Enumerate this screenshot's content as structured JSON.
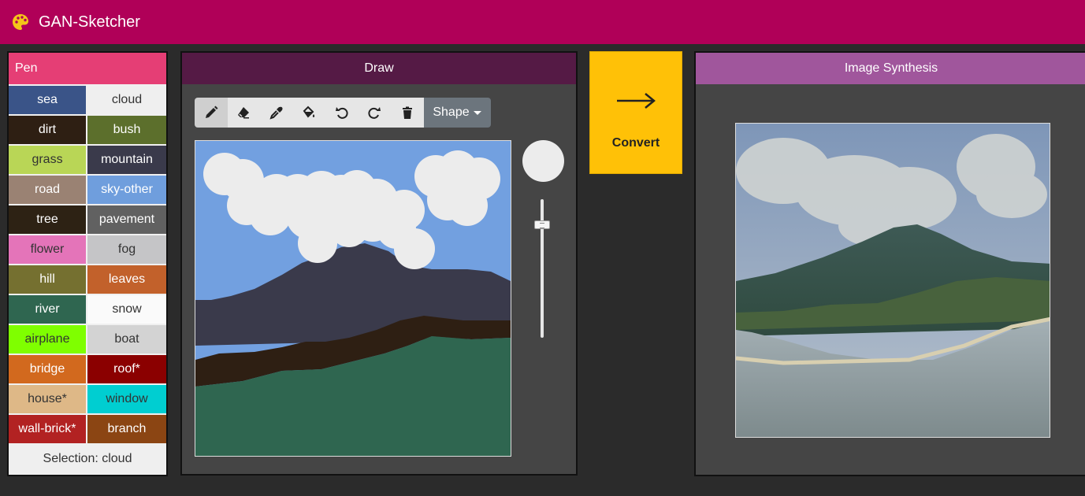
{
  "app": {
    "title": "GAN-Sketcher",
    "logo_icon": "palette-icon"
  },
  "pen": {
    "header": "Pen",
    "items": [
      {
        "label": "sea",
        "bg": "#3a5488",
        "fg": "#ffffff"
      },
      {
        "label": "cloud",
        "bg": "#efefef",
        "fg": "#333333"
      },
      {
        "label": "dirt",
        "bg": "#2e1f13",
        "fg": "#ffffff"
      },
      {
        "label": "bush",
        "bg": "#5c6f2c",
        "fg": "#ffffff"
      },
      {
        "label": "grass",
        "bg": "#b9d656",
        "fg": "#333333"
      },
      {
        "label": "mountain",
        "bg": "#3a3a4b",
        "fg": "#ffffff"
      },
      {
        "label": "road",
        "bg": "#9a8273",
        "fg": "#ffffff"
      },
      {
        "label": "sky-other",
        "bg": "#6f9edd",
        "fg": "#ffffff"
      },
      {
        "label": "tree",
        "bg": "#2d2214",
        "fg": "#ffffff"
      },
      {
        "label": "pavement",
        "bg": "#616161",
        "fg": "#ffffff"
      },
      {
        "label": "flower",
        "bg": "#e474b9",
        "fg": "#333333"
      },
      {
        "label": "fog",
        "bg": "#c5c5c7",
        "fg": "#333333"
      },
      {
        "label": "hill",
        "bg": "#757030",
        "fg": "#ffffff"
      },
      {
        "label": "leaves",
        "bg": "#c2612b",
        "fg": "#ffffff"
      },
      {
        "label": "river",
        "bg": "#2f6650",
        "fg": "#ffffff"
      },
      {
        "label": "snow",
        "bg": "#fafafa",
        "fg": "#333333"
      },
      {
        "label": "airplane",
        "bg": "#7fff00",
        "fg": "#333333"
      },
      {
        "label": "boat",
        "bg": "#d3d3d3",
        "fg": "#333333"
      },
      {
        "label": "bridge",
        "bg": "#d2691e",
        "fg": "#ffffff"
      },
      {
        "label": "roof*",
        "bg": "#8b0000",
        "fg": "#ffffff"
      },
      {
        "label": "house*",
        "bg": "#deb887",
        "fg": "#333333"
      },
      {
        "label": "window",
        "bg": "#00ced1",
        "fg": "#333333"
      },
      {
        "label": "wall-brick*",
        "bg": "#b22222",
        "fg": "#ffffff"
      },
      {
        "label": "branch",
        "bg": "#8b4513",
        "fg": "#ffffff"
      }
    ],
    "selection": "Selection: cloud"
  },
  "draw": {
    "header": "Draw",
    "tools": [
      {
        "name": "pencil-icon",
        "active": true
      },
      {
        "name": "eraser-icon",
        "active": false
      },
      {
        "name": "eyedropper-icon",
        "active": false
      },
      {
        "name": "fill-bucket-icon",
        "active": false
      },
      {
        "name": "undo-icon",
        "active": false
      },
      {
        "name": "redo-icon",
        "active": false
      },
      {
        "name": "trash-icon",
        "active": false
      }
    ],
    "shape_label": "Shape",
    "brush_color": "#ececec"
  },
  "convert": {
    "label": "Convert",
    "arrow": "⟶"
  },
  "synthesis": {
    "header": "Image Synthesis"
  },
  "colors": {
    "navbar": "#b00058",
    "pen_header": "#e53e75",
    "draw_header": "#551a45",
    "synth_header": "#a0569c",
    "convert": "#ffc107"
  }
}
